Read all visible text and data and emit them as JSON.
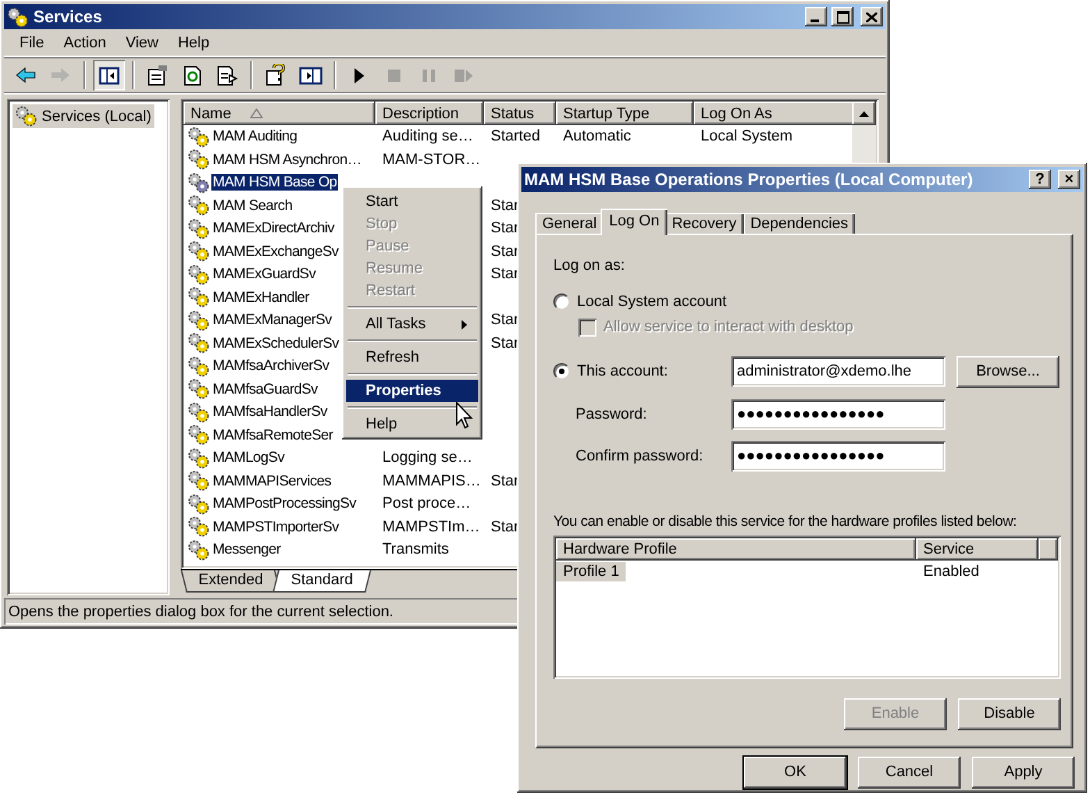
{
  "services_window": {
    "title": "Services",
    "menu": [
      "File",
      "Action",
      "View",
      "Help"
    ],
    "toolbar": [
      {
        "kind": "back",
        "disabled": false,
        "pressed": false
      },
      {
        "kind": "forward",
        "disabled": true,
        "pressed": false
      },
      {
        "kind": "separator"
      },
      {
        "kind": "tree",
        "disabled": false,
        "pressed": true
      },
      {
        "kind": "separator"
      },
      {
        "kind": "properties",
        "disabled": false,
        "pressed": false
      },
      {
        "kind": "refresh",
        "disabled": false,
        "pressed": false
      },
      {
        "kind": "export",
        "disabled": false,
        "pressed": false
      },
      {
        "kind": "separator"
      },
      {
        "kind": "help",
        "disabled": false,
        "pressed": false
      },
      {
        "kind": "console",
        "disabled": false,
        "pressed": false
      },
      {
        "kind": "separator"
      },
      {
        "kind": "play",
        "disabled": false,
        "pressed": false
      },
      {
        "kind": "stop",
        "disabled": true,
        "pressed": false
      },
      {
        "kind": "pause",
        "disabled": true,
        "pressed": false
      },
      {
        "kind": "restart",
        "disabled": true,
        "pressed": false
      }
    ],
    "tree": [
      {
        "label": "Services (Local)",
        "selected": true
      }
    ],
    "table": {
      "columns": [
        "Name",
        "Description",
        "Status",
        "Startup Type",
        "Log On As"
      ],
      "rows": [
        {
          "name": "MAM Auditing",
          "description": "Auditing se…",
          "status": "Started",
          "startup_type": "Automatic",
          "log_on_as": "Local System",
          "selected": false
        },
        {
          "name": "MAM HSM Asynchron…",
          "description": "MAM-STOR…",
          "selected": false
        },
        {
          "name": "MAM HSM Base Op",
          "selected": true
        },
        {
          "name": "MAM Search",
          "status": "Star",
          "selected": false
        },
        {
          "name": "MAMExDirectArchiv",
          "status": "Star",
          "selected": false
        },
        {
          "name": "MAMExExchangeSv",
          "status": "Star",
          "selected": false
        },
        {
          "name": "MAMExGuardSv",
          "status": "Star",
          "selected": false
        },
        {
          "name": "MAMExHandler",
          "selected": false
        },
        {
          "name": "MAMExManagerSv",
          "status": "Star",
          "selected": false
        },
        {
          "name": "MAMExSchedulerSv",
          "status": "Star",
          "selected": false
        },
        {
          "name": "MAMfsaArchiverSv",
          "selected": false
        },
        {
          "name": "MAMfsaGuardSv",
          "selected": false
        },
        {
          "name": "MAMfsaHandlerSv",
          "selected": false
        },
        {
          "name": "MAMfsaRemoteSer",
          "selected": false
        },
        {
          "name": "MAMLogSv",
          "description": "Logging se…",
          "selected": false
        },
        {
          "name": "MAMMAPIServices",
          "description": "MAMMAPIS…",
          "status": "Star",
          "selected": false
        },
        {
          "name": "MAMPostProcessingSv",
          "description": "Post proce…",
          "selected": false
        },
        {
          "name": "MAMPSTImporterSv",
          "description": "MAMPSTIm…",
          "status": "Star",
          "selected": false
        },
        {
          "name": "Messenger",
          "description": "Transmits",
          "selected": false
        }
      ]
    },
    "view_tabs": [
      {
        "label": "Extended",
        "selected": false
      },
      {
        "label": "Standard",
        "selected": true
      }
    ],
    "status_bar": "Opens the properties dialog box for the current selection."
  },
  "context_menu": [
    {
      "kind": "item",
      "label": "Start",
      "disabled": false,
      "selected": false
    },
    {
      "kind": "item",
      "label": "Stop",
      "disabled": true,
      "selected": false
    },
    {
      "kind": "item",
      "label": "Pause",
      "disabled": true,
      "selected": false
    },
    {
      "kind": "item",
      "label": "Resume",
      "disabled": true,
      "selected": false
    },
    {
      "kind": "item",
      "label": "Restart",
      "disabled": true,
      "selected": false
    },
    {
      "kind": "separator"
    },
    {
      "kind": "submenu",
      "label": "All Tasks",
      "disabled": false,
      "selected": false
    },
    {
      "kind": "separator"
    },
    {
      "kind": "item",
      "label": "Refresh",
      "disabled": false,
      "selected": false
    },
    {
      "kind": "separator"
    },
    {
      "kind": "item",
      "label": "Properties",
      "disabled": false,
      "selected": true
    },
    {
      "kind": "separator"
    },
    {
      "kind": "item",
      "label": "Help",
      "disabled": false,
      "selected": false
    }
  ],
  "dialog": {
    "title": "MAM HSM Base Operations Properties (Local Computer)",
    "help_button": "?",
    "close_button": "×",
    "tabs": [
      {
        "label": "General",
        "selected": false
      },
      {
        "label": "Log On",
        "selected": true
      },
      {
        "label": "Recovery",
        "selected": false
      },
      {
        "label": "Dependencies",
        "selected": false
      }
    ],
    "log_on_as": "Log on as:",
    "local_system": {
      "label": "Local System account",
      "selected": false
    },
    "interact": {
      "label": "Allow service to interact with desktop",
      "checked": false,
      "disabled": true
    },
    "this_account": {
      "label": "This account:",
      "selected": true,
      "value": "administrator@xdemo.lhe",
      "browse": "Browse..."
    },
    "password": {
      "label": "Password:",
      "value": "●●●●●●●●●●●●●●●●"
    },
    "confirm": {
      "label": "Confirm password:",
      "value": "●●●●●●●●●●●●●●●●"
    },
    "profiles_hint": "You can enable or disable this service for the hardware profiles listed below:",
    "profiles": {
      "columns": [
        "Hardware Profile",
        "Service"
      ],
      "rows": [
        {
          "profile": "Profile 1",
          "service": "Enabled",
          "selected": true
        }
      ]
    },
    "profile_buttons": [
      {
        "label": "Enable",
        "disabled": true
      },
      {
        "label": "Disable",
        "disabled": false
      }
    ],
    "buttons": [
      {
        "label": "OK",
        "default": true
      },
      {
        "label": "Cancel",
        "default": false
      },
      {
        "label": "Apply",
        "default": false
      }
    ]
  }
}
